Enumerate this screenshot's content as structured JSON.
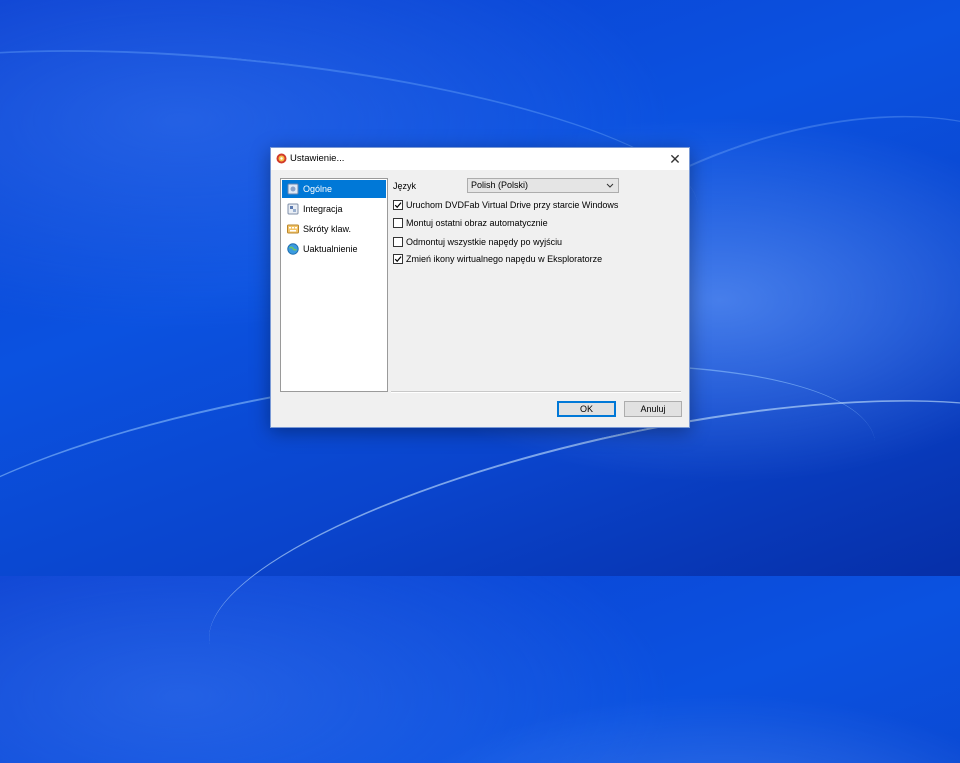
{
  "window": {
    "title": "Ustawienie...",
    "close_glyph": "✕",
    "app_icon": "dvdfab-icon"
  },
  "sidebar": {
    "items": [
      {
        "label": "Ogólne",
        "icon": "general-settings-icon",
        "selected": true
      },
      {
        "label": "Integracja",
        "icon": "integration-icon",
        "selected": false
      },
      {
        "label": "Skróty klaw.",
        "icon": "keyboard-shortcuts-icon",
        "selected": false
      },
      {
        "label": "Uaktualnienie",
        "icon": "update-globe-icon",
        "selected": false
      }
    ]
  },
  "general": {
    "language_label": "Język",
    "language_value": "Polish (Polski)",
    "options": [
      {
        "label": "Uruchom DVDFab Virtual Drive przy starcie Windows",
        "checked": true
      },
      {
        "label": "Montuj ostatni obraz automatycznie",
        "checked": false
      },
      {
        "label": "Odmontuj wszystkie napędy po wyjściu",
        "checked": false
      },
      {
        "label": "Zmień ikony wirtualnego napędu w Eksploratorze",
        "checked": true
      }
    ]
  },
  "buttons": {
    "ok": "OK",
    "cancel": "Anuluj"
  },
  "colors": {
    "selection": "#0078d7",
    "dialog_bg": "#f0f0f0",
    "desktop": "#0b52e0"
  }
}
